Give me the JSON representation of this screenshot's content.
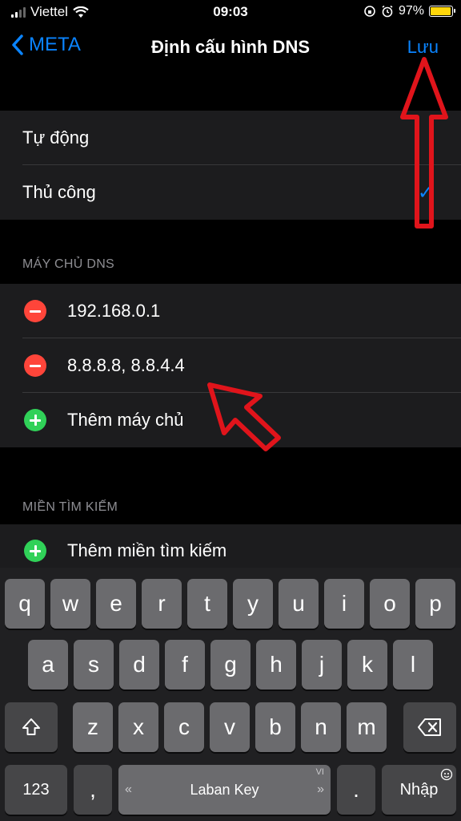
{
  "status_bar": {
    "carrier": "Viettel",
    "time": "09:03",
    "battery": "97%",
    "battery_level": 0.97
  },
  "nav": {
    "back_label": "META",
    "title": "Định cấu hình DNS",
    "save_label": "Lưu"
  },
  "dns_mode": {
    "options": [
      "Tự động",
      "Thủ công"
    ],
    "selected": "Thủ công"
  },
  "dns_servers": {
    "section_label": "MÁY CHỦ DNS",
    "servers": [
      "192.168.0.1",
      "8.8.8.8, 8.8.4.4"
    ],
    "add_label": "Thêm máy chủ"
  },
  "search_domains": {
    "section_label": "MIỀN TÌM KIẾM",
    "add_label": "Thêm miền tìm kiếm"
  },
  "keyboard": {
    "row1": [
      "q",
      "w",
      "e",
      "r",
      "t",
      "y",
      "u",
      "i",
      "o",
      "p"
    ],
    "row2": [
      "a",
      "s",
      "d",
      "f",
      "g",
      "h",
      "j",
      "k",
      "l"
    ],
    "row3": [
      "z",
      "x",
      "c",
      "v",
      "b",
      "n",
      "m"
    ],
    "numbers_label": "123",
    "comma_label": ",",
    "space_label": "Laban Key",
    "language_label": "VI",
    "period_label": ".",
    "return_label": "Nhập"
  },
  "colors": {
    "accent": "#0a84ff",
    "background": "#000000",
    "group": "#1c1c1e",
    "delete": "#ff453a",
    "add": "#30d158",
    "annotation": "#e0141b"
  },
  "icons": [
    "wifi-icon",
    "chevron-left-icon",
    "checkmark-icon",
    "alarm-icon",
    "rotation-lock-icon",
    "shift-icon",
    "backspace-icon",
    "globe-icon"
  ]
}
